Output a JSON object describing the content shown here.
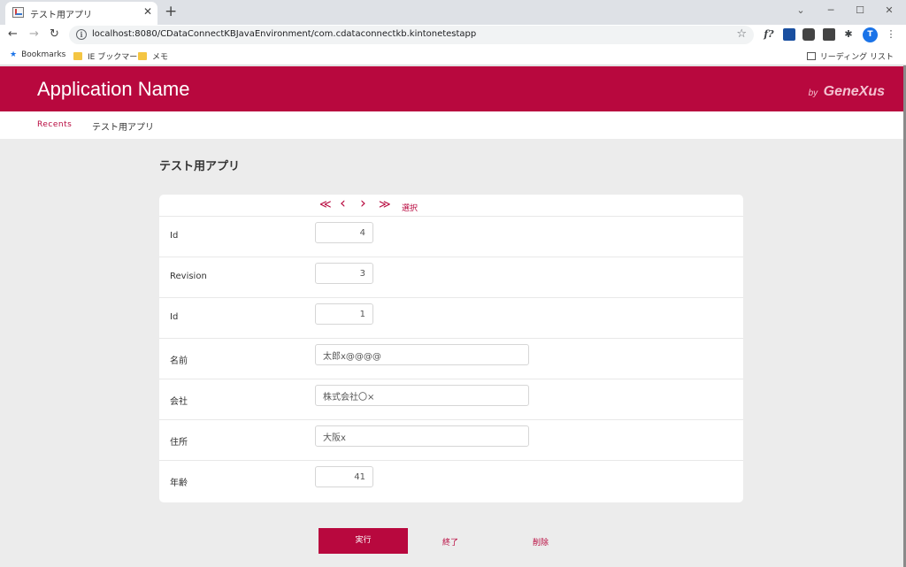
{
  "browser": {
    "tab_title": "テスト用アプリ",
    "tab_close": "✕",
    "new_tab": "+",
    "window_controls": {
      "minimize": "─",
      "maximize": "☐",
      "close": "✕",
      "menu": "⌄"
    },
    "nav": {
      "back": "←",
      "forward": "→",
      "reload": "↻"
    },
    "url": "localhost:8080/CDataConnectKBJavaEnvironment/com.cdataconnectkb.kintonetestapp",
    "info_icon": "i",
    "star_icon": "☆",
    "extension_fx": "f?",
    "extensions_menu": "⋮",
    "avatar_letter": "T",
    "bookmarks": [
      {
        "label": "Bookmarks",
        "icon": "star-icon"
      },
      {
        "label": "IE ブックマーク",
        "icon": "folder-icon"
      },
      {
        "label": "メモ",
        "icon": "folder-icon"
      }
    ],
    "reading_list": "リーディング リスト"
  },
  "app": {
    "name": "Application Name",
    "brand_by": "by",
    "brand_name": "GeneXus",
    "recents_label": "Recents",
    "recents_item": "テスト用アプリ",
    "page_title": "テスト用アプリ"
  },
  "record_nav": {
    "first": "≪",
    "prev": "‹",
    "next": "›",
    "last": "≫",
    "select_label": "選択"
  },
  "fields": [
    {
      "label": "Id",
      "value": "4"
    },
    {
      "label": "Revision",
      "value": "3"
    },
    {
      "label": "Id",
      "value": "1"
    },
    {
      "label": "名前",
      "value": "太郎x@@@@"
    },
    {
      "label": "会社",
      "value": "株式会社〇×"
    },
    {
      "label": "住所",
      "value": "大阪x"
    },
    {
      "label": "年齢",
      "value": "41"
    }
  ],
  "actions": {
    "execute": "実行",
    "close": "終了",
    "delete": "削除"
  },
  "colors": {
    "accent": "#b8083e",
    "background": "#ececec",
    "card": "#ffffff"
  }
}
